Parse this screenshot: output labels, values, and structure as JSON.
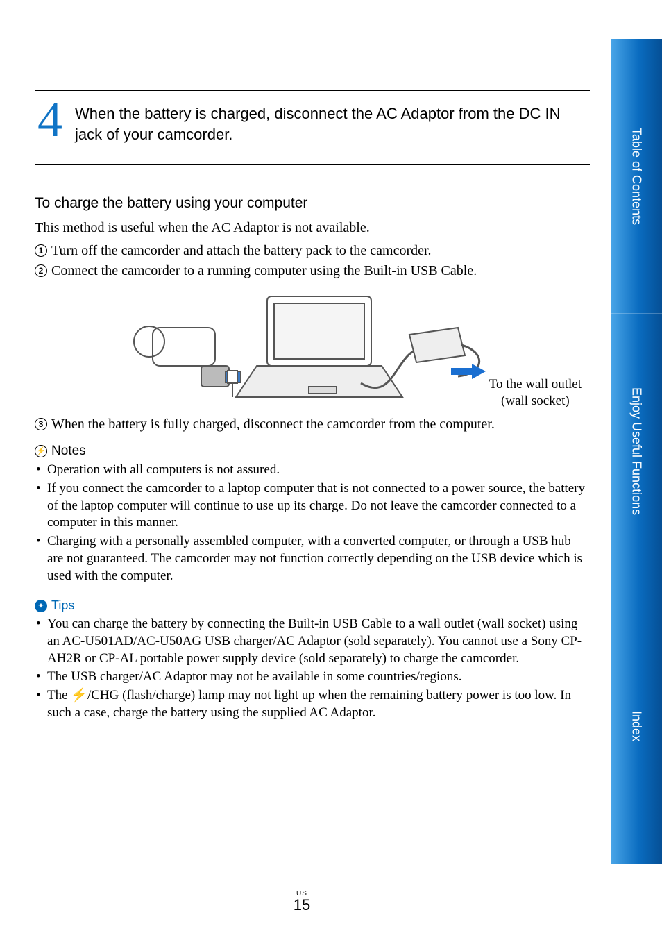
{
  "step": {
    "number": "4",
    "text": "When the battery is charged, disconnect the AC Adaptor from the DC IN jack of your camcorder."
  },
  "section": {
    "heading": "To charge the battery using your computer",
    "intro": "This method is useful when the AC Adaptor is not available.",
    "items": [
      "Turn off the camcorder and attach the battery pack to the camcorder.",
      "Connect the camcorder to a running computer using the Built-in USB Cable."
    ],
    "illus_label_line1": "To the wall outlet",
    "illus_label_line2": "(wall socket)",
    "item3": "When the battery is fully charged, disconnect the camcorder from the computer."
  },
  "notes": {
    "heading": "Notes",
    "bullets": [
      "Operation with all computers is not assured.",
      "If you connect the camcorder to a laptop computer that is not connected to a power source, the battery of the laptop computer will continue to use up its charge. Do not leave the camcorder connected to a computer in this manner.",
      "Charging with a personally assembled computer, with a converted computer, or through a USB hub are not guaranteed. The camcorder may not function correctly depending on the USB device which is used with the computer."
    ]
  },
  "tips": {
    "heading": "Tips",
    "bullets": [
      "You can charge the battery by connecting the Built-in USB Cable to a wall outlet (wall socket) using an AC-U501AD/AC-U50AG USB charger/AC Adaptor (sold separately). You cannot use a Sony CP-AH2R or CP-AL portable power supply device (sold separately) to charge the camcorder.",
      "The USB charger/AC Adaptor may not be available in some countries/regions.",
      "The ⚡/CHG (flash/charge) lamp may not light up when the remaining battery power is too low. In such a case, charge the battery using the supplied AC Adaptor."
    ]
  },
  "sidebar": {
    "tabs": [
      "Table of Contents",
      "Enjoy Useful Functions",
      "Index"
    ]
  },
  "footer": {
    "region": "US",
    "page": "15"
  },
  "glyphs": {
    "circ1": "1",
    "circ2": "2",
    "circ3": "3"
  }
}
